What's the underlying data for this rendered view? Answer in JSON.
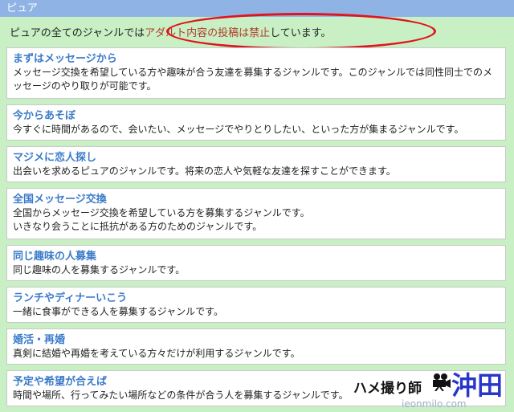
{
  "header": {
    "title": "ピュア"
  },
  "intro": {
    "text_before": "ピュアの全てのジャンルでは",
    "text_warning": "アダルト内容の投稿は禁止",
    "text_after": "しています。"
  },
  "genres": [
    {
      "title": "まずはメッセージから",
      "desc": "メッセージ交換を希望している方や趣味が合う友達を募集するジャンルです。このジャンルでは同性同士でのメッセージのやり取りが可能です。"
    },
    {
      "title": "今からあそぼ",
      "desc": "今すぐに時間があるので、会いたい、メッセージでやりとりしたい、といった方が集まるジャンルです。"
    },
    {
      "title": "マジメに恋人探し",
      "desc": "出会いを求めるピュアのジャンルです。将来の恋人や気軽な友達を探すことができます。"
    },
    {
      "title": "全国メッセージ交換",
      "desc_line1": "全国からメッセージ交換を希望している方を募集するジャンルです。",
      "desc_line2": "いきなり会うことに抵抗がある方のためのジャンルです。"
    },
    {
      "title": "同じ趣味の人募集",
      "desc": "同じ趣味の人を募集するジャンルです。"
    },
    {
      "title": "ランチやディナーいこう",
      "desc": "一緒に食事ができる人を募集するジャンルです。"
    },
    {
      "title": "婚活・再婚",
      "desc": "真剣に結婚や再婚を考えている方々だけが利用するジャンルです。"
    },
    {
      "title": "予定や希望が合えば",
      "desc": "時間や場所、行ってみたい場所などの条件が合う人を募集するジャンルです。"
    }
  ],
  "watermark": {
    "name": "ハメ撮り師",
    "kanji": "沖田",
    "url": "ieonmilo.com"
  },
  "colors": {
    "accent_link": "#3b7bc9",
    "warning": "#e0141e",
    "header_bg": "#8fb3e4",
    "page_bg": "#c9f0c4"
  }
}
